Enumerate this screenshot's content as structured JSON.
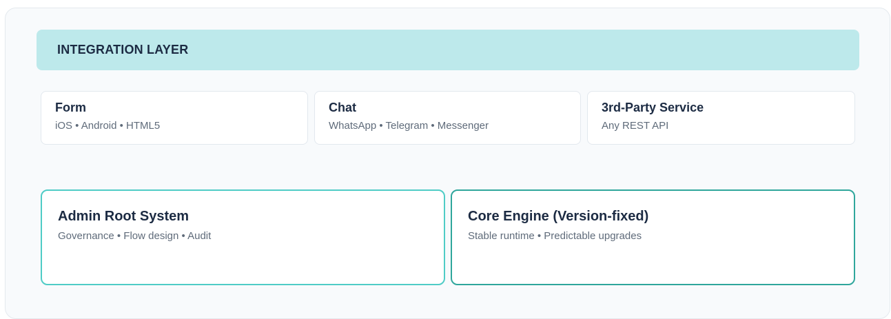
{
  "layer": {
    "title": "INTEGRATION LAYER"
  },
  "channels": [
    {
      "title": "Form",
      "subtitle": "iOS • Android • HTML5"
    },
    {
      "title": "Chat",
      "subtitle": "WhatsApp • Telegram • Messenger"
    },
    {
      "title": "3rd-Party Service",
      "subtitle": "Any REST API"
    }
  ],
  "systems": [
    {
      "title": "Admin Root System",
      "subtitle": "Governance • Flow design • Audit"
    },
    {
      "title": "Core Engine (Version-fixed)",
      "subtitle": "Stable runtime • Predictable upgrades"
    }
  ],
  "colors": {
    "header_bg": "#bde9eb",
    "admin_border": "#4fccc6",
    "core_border": "#2fa69c",
    "title_text": "#1c2b43",
    "sub_text": "#5f6b7a"
  }
}
